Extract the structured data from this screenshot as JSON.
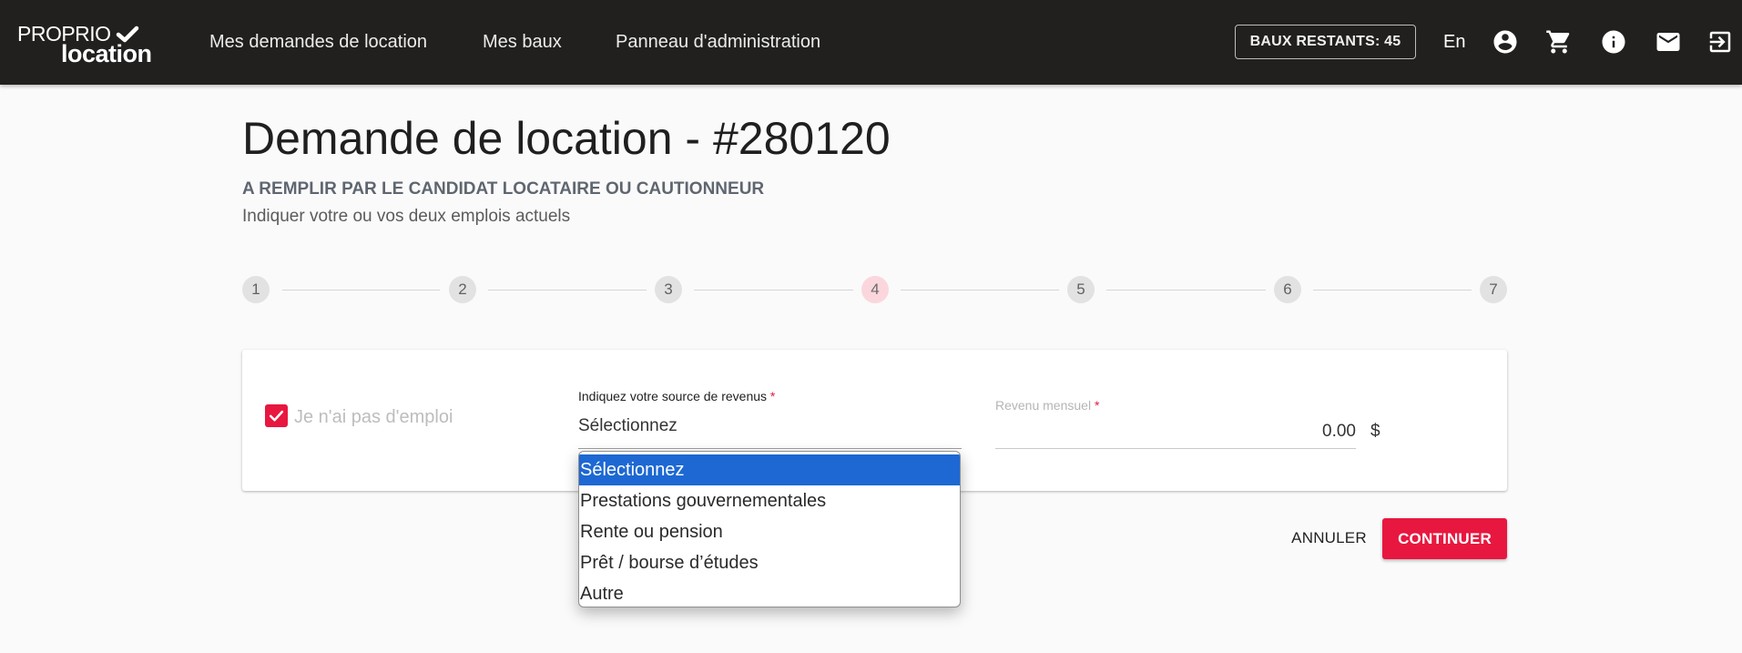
{
  "header": {
    "logo": {
      "line1": "PROPRIO",
      "line2": "location"
    },
    "nav": [
      {
        "label": "Mes demandes de location"
      },
      {
        "label": "Mes baux"
      },
      {
        "label": "Panneau d'administration"
      }
    ],
    "baux_badge": "BAUX RESTANTS: 45",
    "language": "En",
    "icons": [
      "account-circle-icon",
      "cart-icon",
      "info-icon",
      "mail-icon",
      "logout-icon"
    ]
  },
  "page": {
    "title": "Demande de location - #280120",
    "subtitle_bold": "A REMPLIR PAR LE CANDIDAT LOCATAIRE OU CAUTIONNEUR",
    "subtitle": "Indiquer votre ou vos deux emplois actuels"
  },
  "stepper": {
    "steps": [
      "1",
      "2",
      "3",
      "4",
      "5",
      "6",
      "7"
    ],
    "active_step": "4"
  },
  "form": {
    "no_job_checkbox": {
      "label": "Je n'ai pas d'emploi",
      "checked": true
    },
    "income_source": {
      "label": "Indiquez votre source de revenus",
      "required_mark": "*",
      "value": "Sélectionnez",
      "options": [
        "Sélectionnez",
        "Prestations gouvernementales",
        "Rente ou pension",
        "Prêt / bourse d’études",
        "Autre"
      ],
      "highlighted": "Sélectionnez"
    },
    "monthly_income": {
      "label": "Revenu mensuel",
      "required_mark": "*",
      "value": "0.00",
      "currency": "$"
    }
  },
  "actions": {
    "cancel_label": "ANNULER",
    "continue_label": "CONTINUER"
  },
  "colors": {
    "topbar": "#21201f",
    "accent": "#e8173f",
    "active_step_bg": "#fbd7dd",
    "dropdown_selected": "#1d68d3"
  }
}
